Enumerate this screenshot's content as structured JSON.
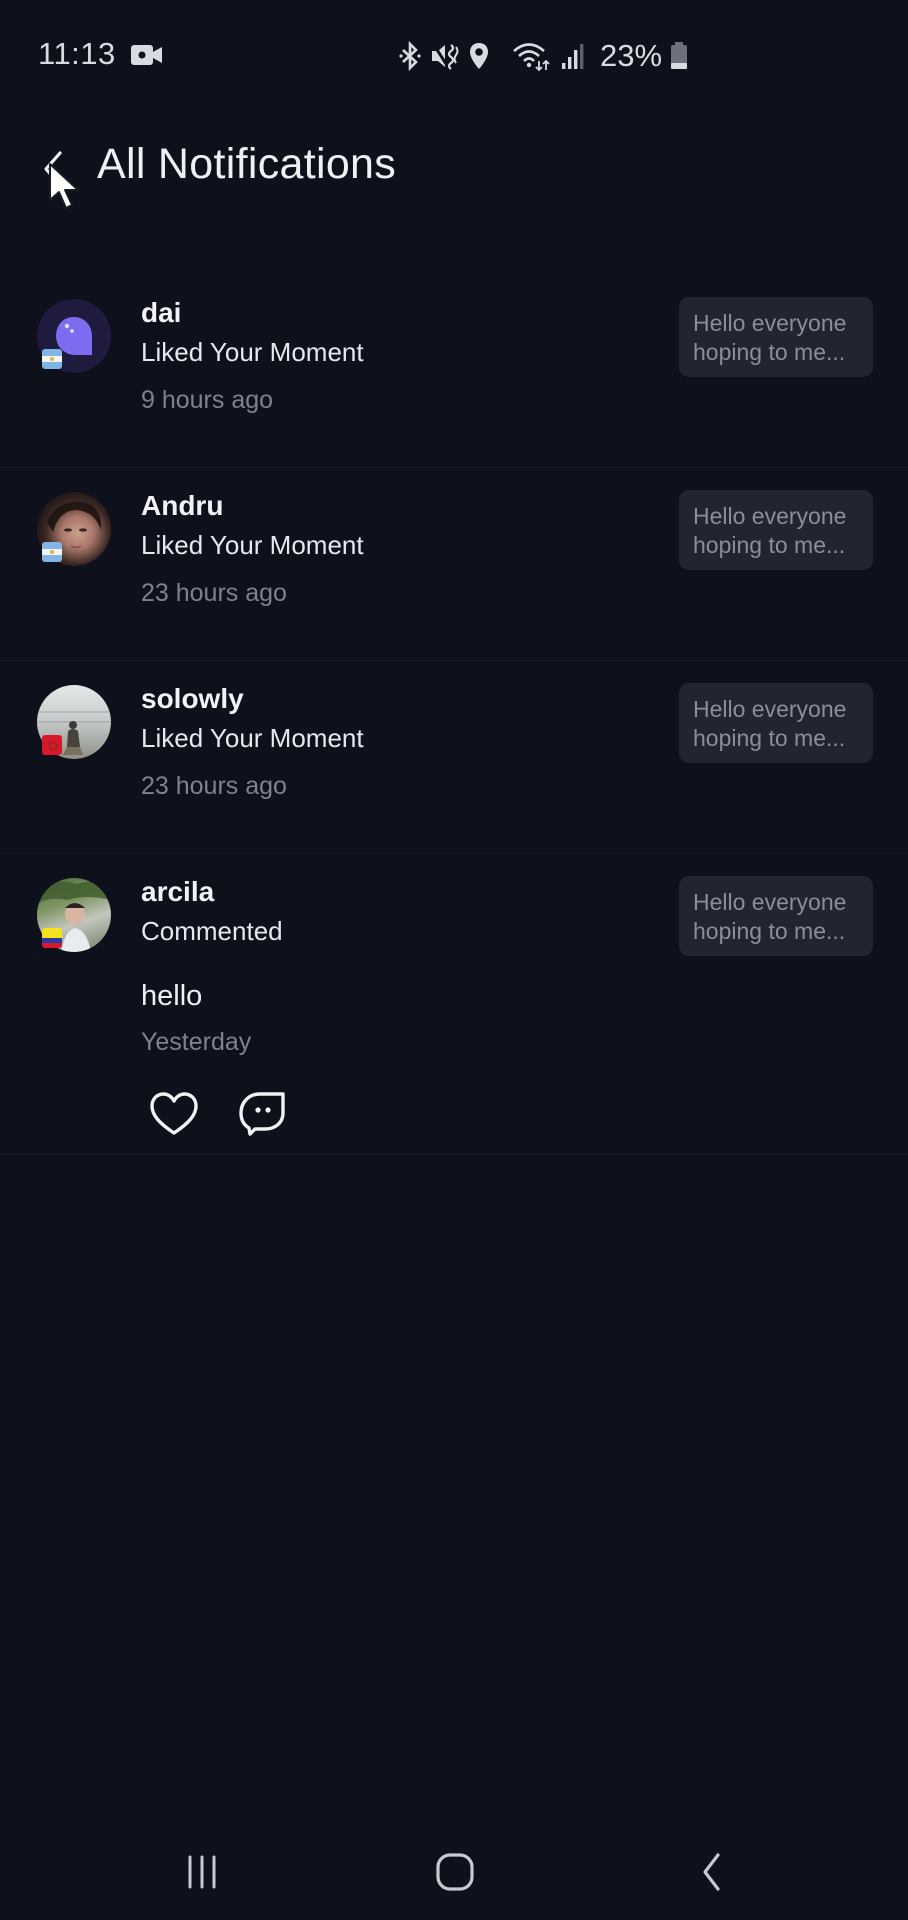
{
  "status_bar": {
    "time": "11:13",
    "battery_percent": "23%",
    "battery_level": 0.23,
    "icons": [
      "video-record-icon",
      "bluetooth-icon",
      "mute-vibrate-icon",
      "location-icon",
      "wifi-icon",
      "signal-icon",
      "battery-icon"
    ]
  },
  "header": {
    "title": "All Notifications",
    "back_icon": "chevron-left-icon"
  },
  "notifications": [
    {
      "username": "dai",
      "action": "Liked Your Moment",
      "time": "9 hours ago",
      "preview": "Hello everyone hoping to me...",
      "preview_line1": "Hello everyone",
      "preview_line2": "hoping to me...",
      "flag": "argentina",
      "avatar": "default-purple-bubble"
    },
    {
      "username": "Andru",
      "action": "Liked Your Moment",
      "time": "23 hours ago",
      "preview": "Hello everyone hoping to me...",
      "preview_line1": "Hello everyone",
      "preview_line2": "hoping to me...",
      "flag": "argentina",
      "avatar": "photo"
    },
    {
      "username": "solowly",
      "action": "Liked Your Moment",
      "time": "23 hours ago",
      "preview": "Hello everyone hoping to me...",
      "preview_line1": "Hello everyone",
      "preview_line2": "hoping to me...",
      "flag": "red-flag",
      "avatar": "photo"
    },
    {
      "username": "arcila",
      "action": "Commented",
      "comment": "hello",
      "time": "Yesterday",
      "preview": "Hello everyone hoping to me...",
      "preview_line1": "Hello everyone",
      "preview_line2": "hoping to me...",
      "flag": "colombia",
      "avatar": "photo",
      "actions": [
        "heart-icon",
        "reply-comment-icon"
      ]
    }
  ],
  "nav_bar": {
    "buttons": [
      "recent-apps",
      "home",
      "back"
    ]
  },
  "colors": {
    "background": "#0e101b",
    "preview_bg": "#22252f",
    "muted_text": "#7d8190",
    "accent_purple": "#7b6cf0"
  }
}
